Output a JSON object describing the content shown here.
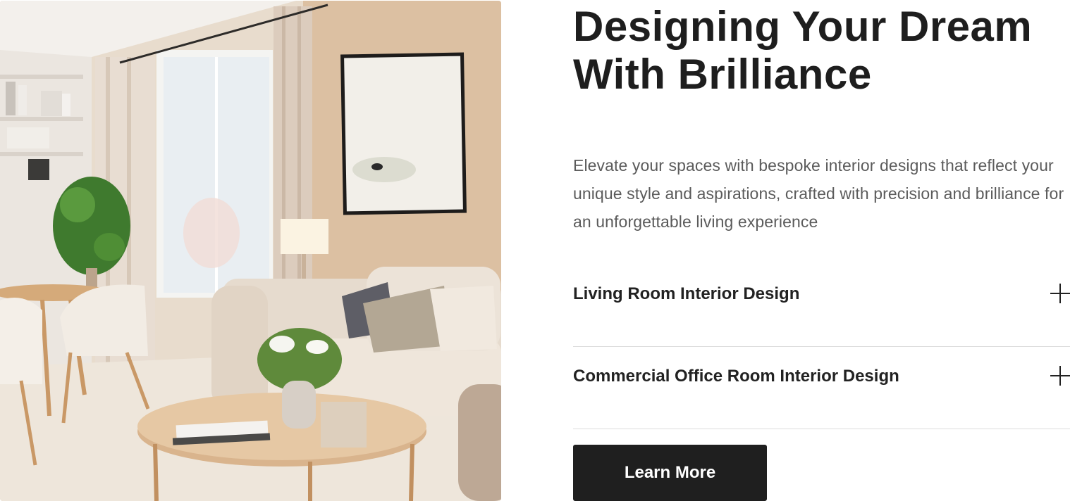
{
  "hero": {
    "image_name": "living-room-interior-photo"
  },
  "headline": {
    "line1": "Designing Your Dream",
    "line2": "With Brilliance"
  },
  "description": "Elevate your spaces with bespoke interior designs that reflect your unique style and aspirations, crafted with precision and brilliance for an unforgettable living experience",
  "accordion": {
    "items": [
      {
        "label": "Living Room Interior Design",
        "icon": "plus-icon"
      },
      {
        "label": "Commercial Office Room Interior Design",
        "icon": "plus-icon"
      }
    ]
  },
  "cta": {
    "label": "Learn More"
  },
  "colors": {
    "text_dark": "#1e1e1e",
    "text_muted": "#5b5b5b",
    "button_bg": "#1f1f1f",
    "divider": "#dcdcdc"
  }
}
